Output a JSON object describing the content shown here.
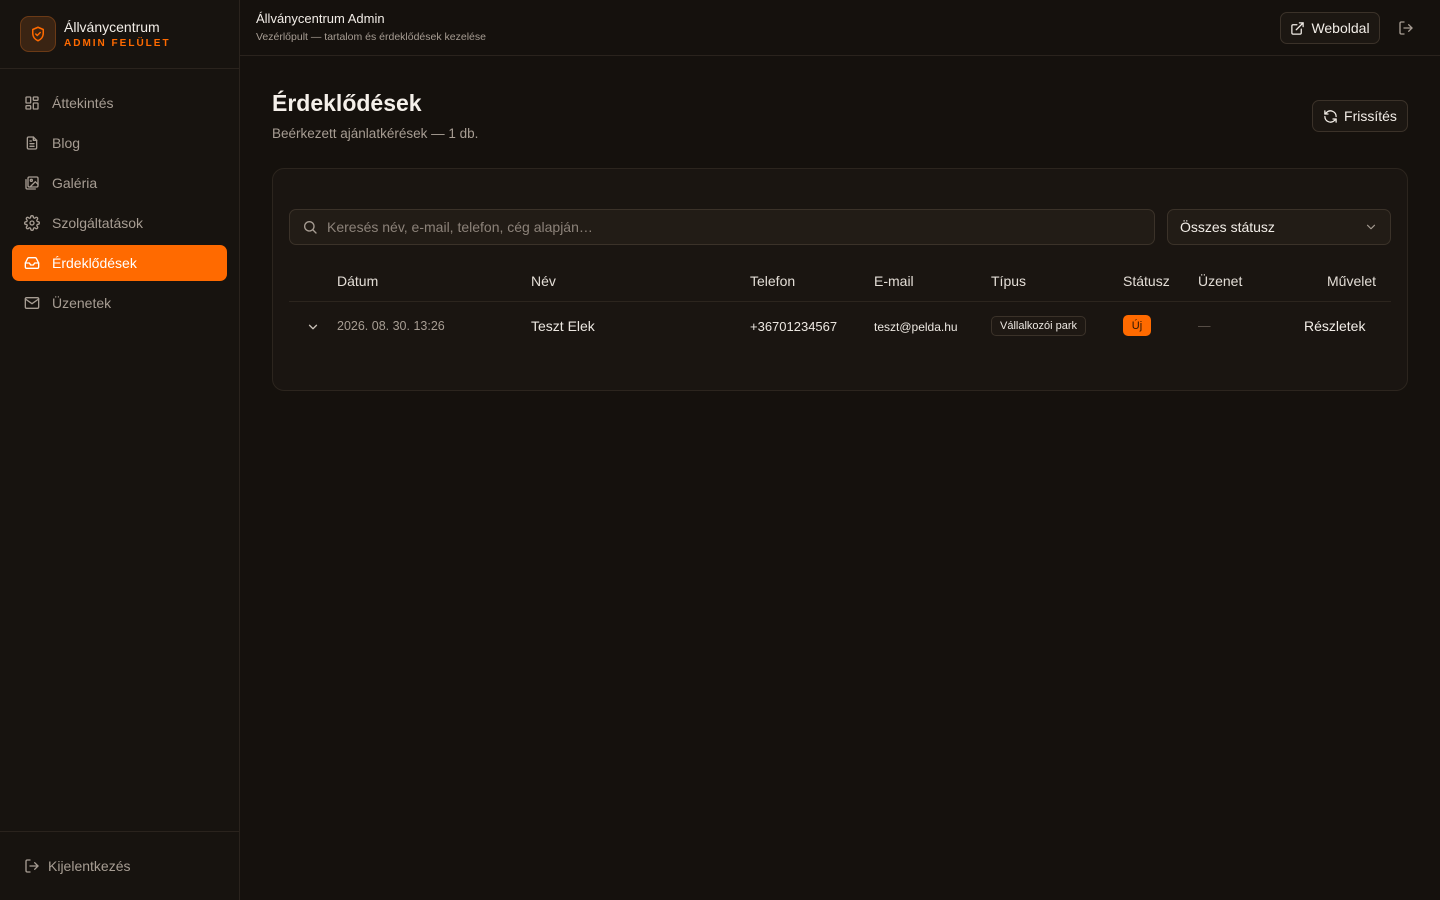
{
  "brand": {
    "name": "Állványcentrum",
    "subtitle": "ADMIN FELÜLET",
    "icon": "shield-icon"
  },
  "sidebar": {
    "items": [
      {
        "label": "Áttekintés",
        "icon": "dashboard-icon"
      },
      {
        "label": "Blog",
        "icon": "document-icon"
      },
      {
        "label": "Galéria",
        "icon": "gallery-icon"
      },
      {
        "label": "Szolgáltatások",
        "icon": "gear-icon"
      },
      {
        "label": "Érdeklődések",
        "icon": "inbox-icon",
        "active": true
      },
      {
        "label": "Üzenetek",
        "icon": "mail-icon"
      }
    ],
    "logout_label": "Kijelentkezés"
  },
  "header": {
    "title": "Állványcentrum Admin",
    "subtitle": "Vezérlőpult — tartalom és érdeklődések kezelése",
    "website_label": "Weboldal"
  },
  "main": {
    "title": "Érdeklődések",
    "subtitle": "Beérkezett ajánlatkérések — 1 db.",
    "refresh_label": "Frissítés"
  },
  "filters": {
    "search_placeholder": "Keresés név, e-mail, telefon, cég alapján…",
    "status_selected": "Összes státusz"
  },
  "table": {
    "columns": {
      "date": "Dátum",
      "name": "Név",
      "phone": "Telefon",
      "email": "E-mail",
      "type": "Típus",
      "status": "Státusz",
      "message": "Üzenet",
      "action": "Művelet"
    },
    "rows": [
      {
        "date": "2026. 08. 30. 13:26",
        "name": "Teszt Elek",
        "phone": "+36701234567",
        "email": "teszt@pelda.hu",
        "type": "Vállalkozói park",
        "status": "Új",
        "message": "—",
        "action": "Részletek"
      }
    ]
  },
  "colors": {
    "accent": "#ff6a00",
    "background": "#15110d",
    "sidebar": "#17130f",
    "card": "#1a1511"
  }
}
